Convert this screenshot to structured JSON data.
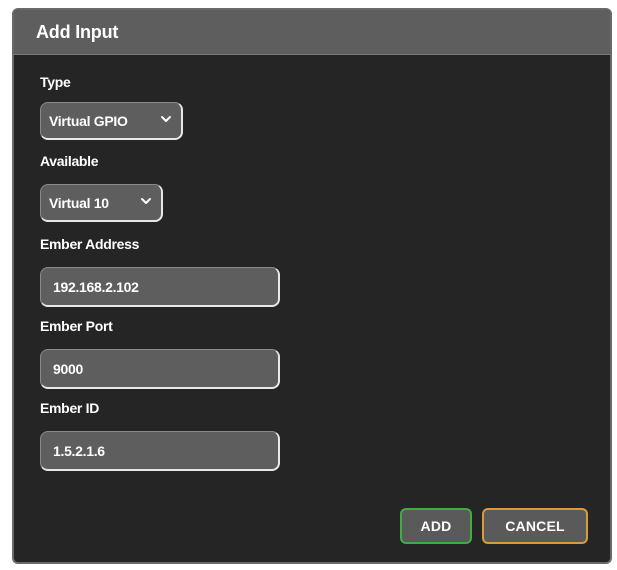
{
  "dialog": {
    "title": "Add Input"
  },
  "fields": {
    "type": {
      "label": "Type",
      "value": "Virtual GPIO"
    },
    "available": {
      "label": "Available",
      "value": "Virtual 10"
    },
    "ember_address": {
      "label": "Ember Address",
      "value": "192.168.2.102"
    },
    "ember_port": {
      "label": "Ember Port",
      "value": "9000"
    },
    "ember_id": {
      "label": "Ember ID",
      "value": "1.5.2.1.6"
    }
  },
  "buttons": {
    "add_label": "ADD",
    "cancel_label": "CANCEL"
  },
  "colors": {
    "add_border": "#3fae3f",
    "cancel_border": "#d99a3a",
    "dialog_bg": "#252525",
    "header_bg": "#5e5e5e"
  },
  "icons": {
    "dropdown": "chevron-down-icon"
  }
}
